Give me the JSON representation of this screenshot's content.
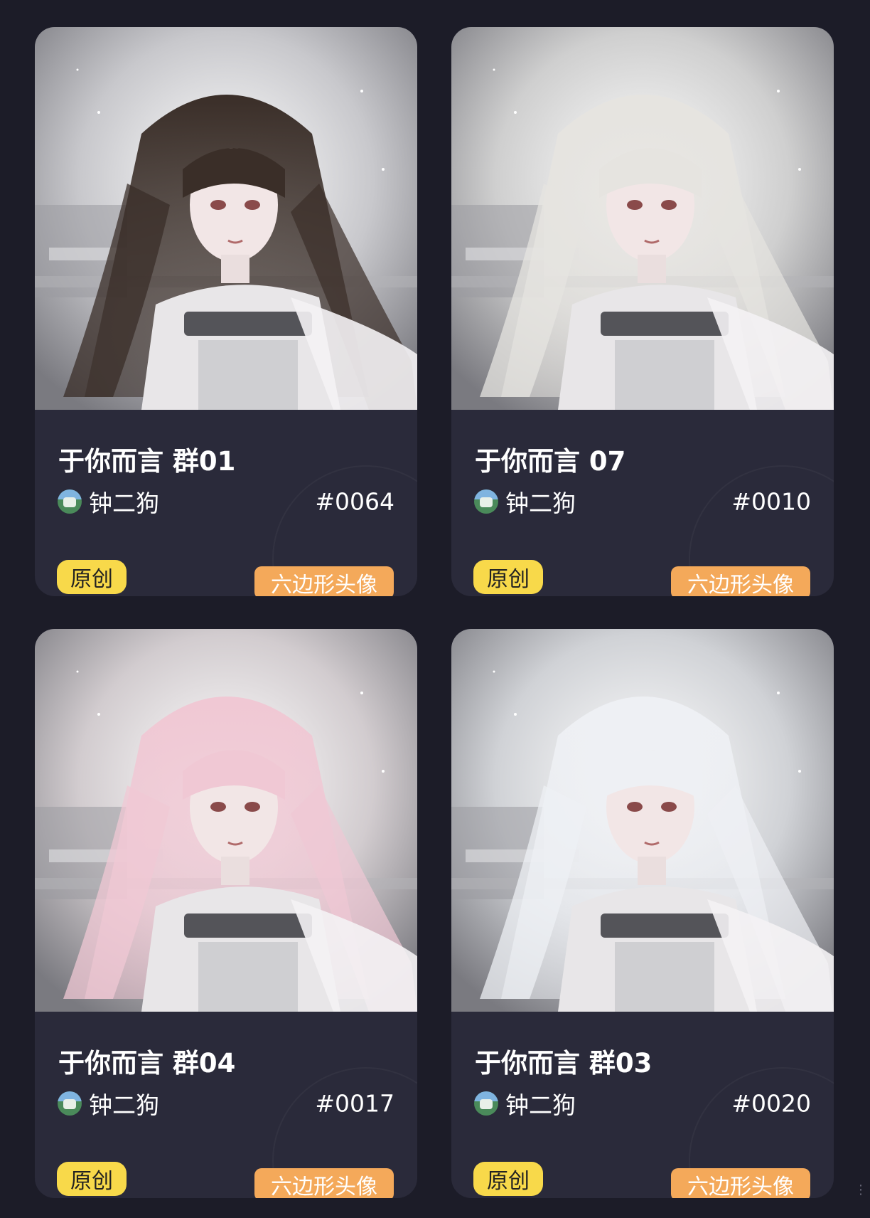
{
  "colors": {
    "background": "#1c1c28",
    "card": "#2a2a3a",
    "badge_original": "#f8d94a",
    "badge_type": "#f4a95a"
  },
  "cards": [
    {
      "title": "于你而言 群01",
      "creator": "钟二狗",
      "serial": "#0064",
      "badge_original": "原创",
      "badge_type": "六边形头像",
      "hair_color": "#3a2e28",
      "tint": "#c8c8cc"
    },
    {
      "title": "于你而言 07",
      "creator": "钟二狗",
      "serial": "#0010",
      "badge_original": "原创",
      "badge_type": "六边形头像",
      "hair_color": "#e6e4e0",
      "tint": "#cfcfcf"
    },
    {
      "title": "于你而言 群04",
      "creator": "钟二狗",
      "serial": "#0017",
      "badge_original": "原创",
      "badge_type": "六边形头像",
      "hair_color": "#f0c8d4",
      "tint": "#d2cccf"
    },
    {
      "title": "于你而言 群03",
      "creator": "钟二狗",
      "serial": "#0020",
      "badge_original": "原创",
      "badge_type": "六边形头像",
      "hair_color": "#eef0f4",
      "tint": "#d0d2d6"
    }
  ]
}
